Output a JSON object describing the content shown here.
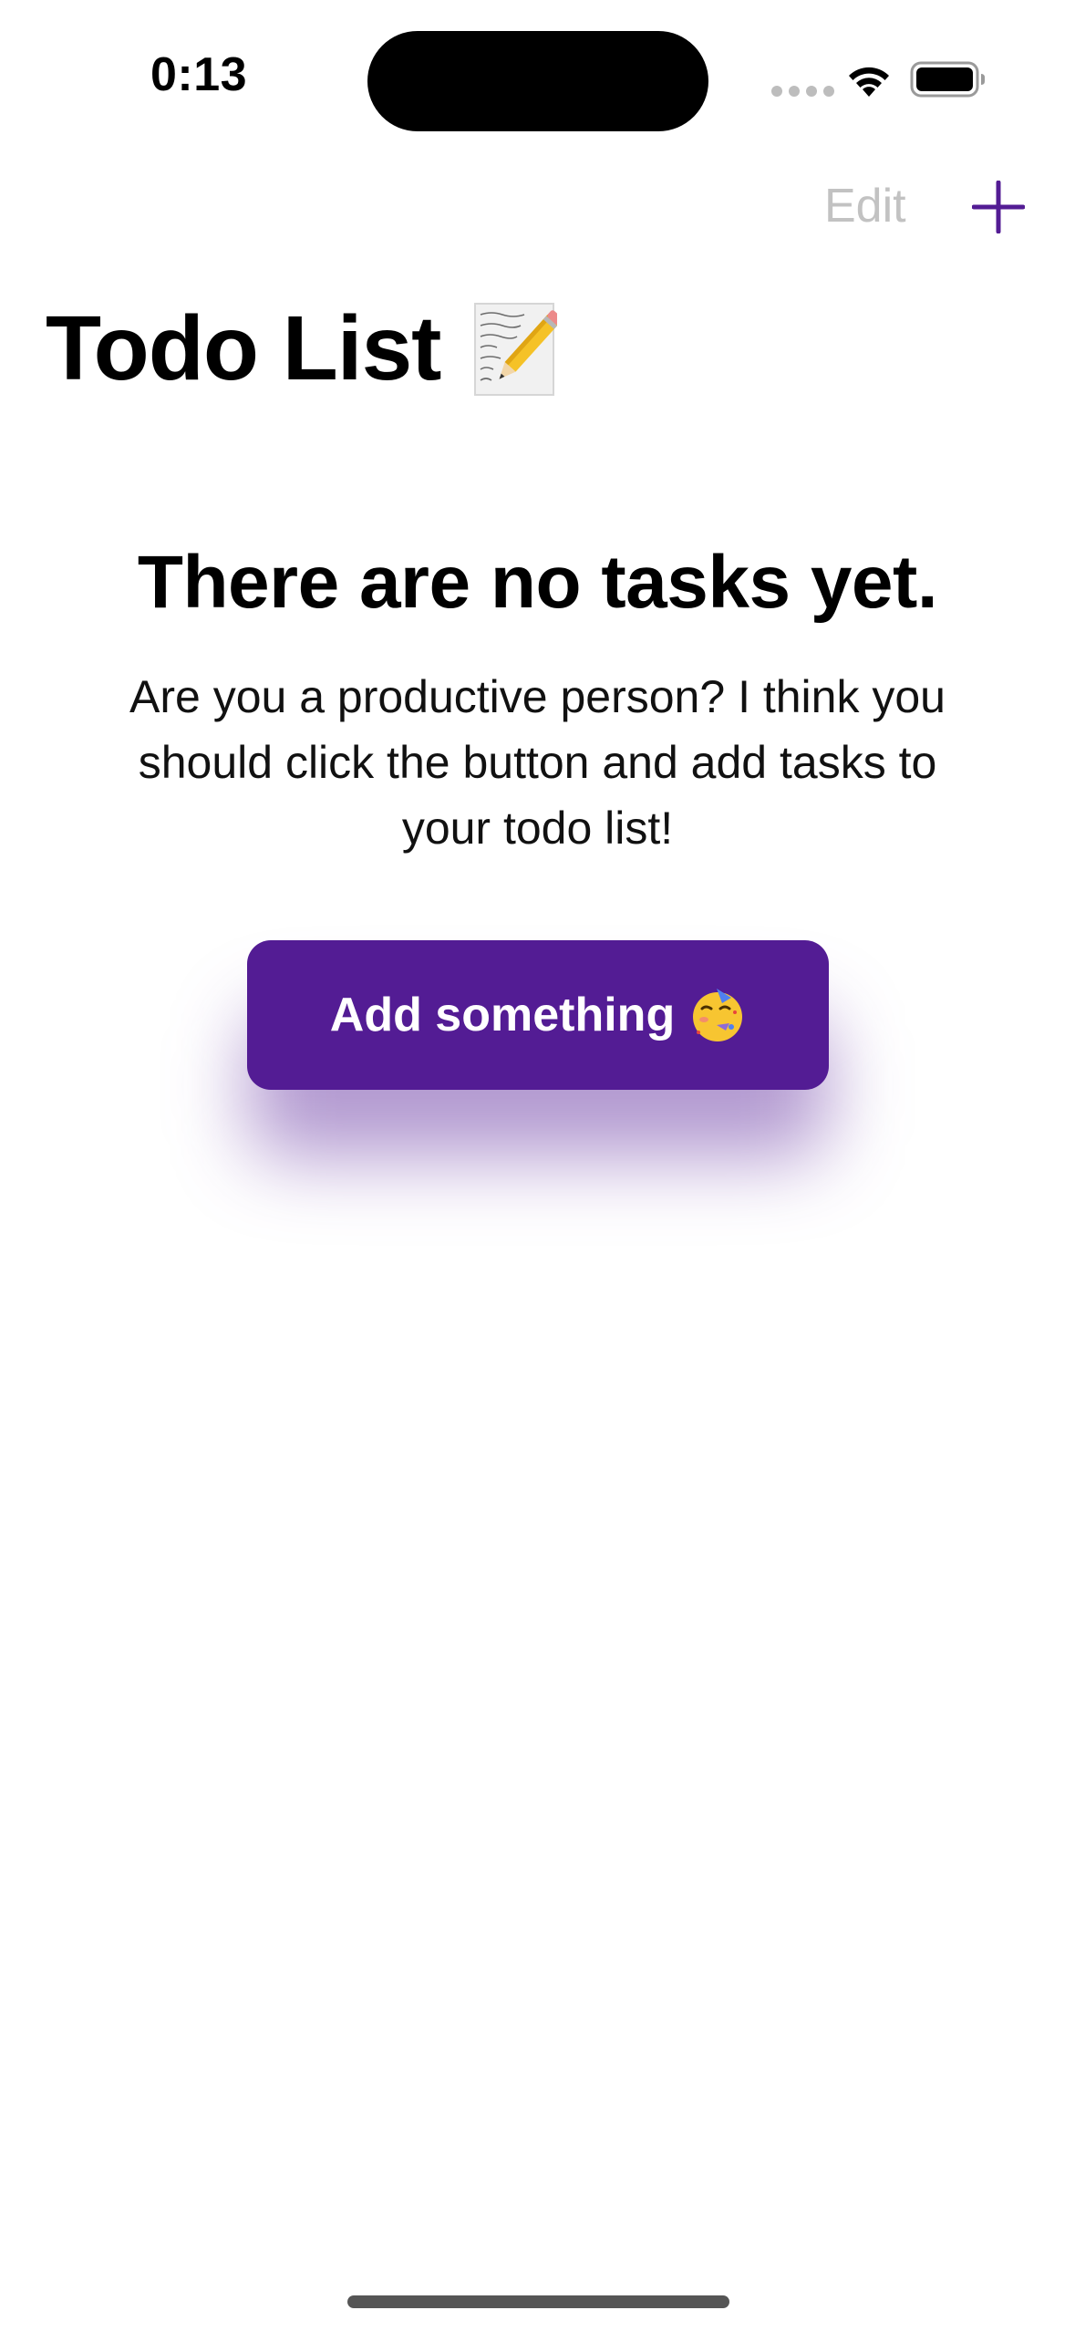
{
  "status_bar": {
    "time": "0:13"
  },
  "nav": {
    "edit_label": "Edit",
    "add_icon": "plus-icon",
    "accent_color": "#531c94",
    "edit_color": "#c2c2c2"
  },
  "header": {
    "title": "Todo List",
    "title_icon": "memo-icon"
  },
  "empty_state": {
    "heading": "There are no tasks yet.",
    "message": "Are you a productive person? I think you should click the button and add tasks to your todo list!",
    "button_label": "Add something",
    "button_icon": "partying-face-icon",
    "button_color": "#531c94"
  }
}
